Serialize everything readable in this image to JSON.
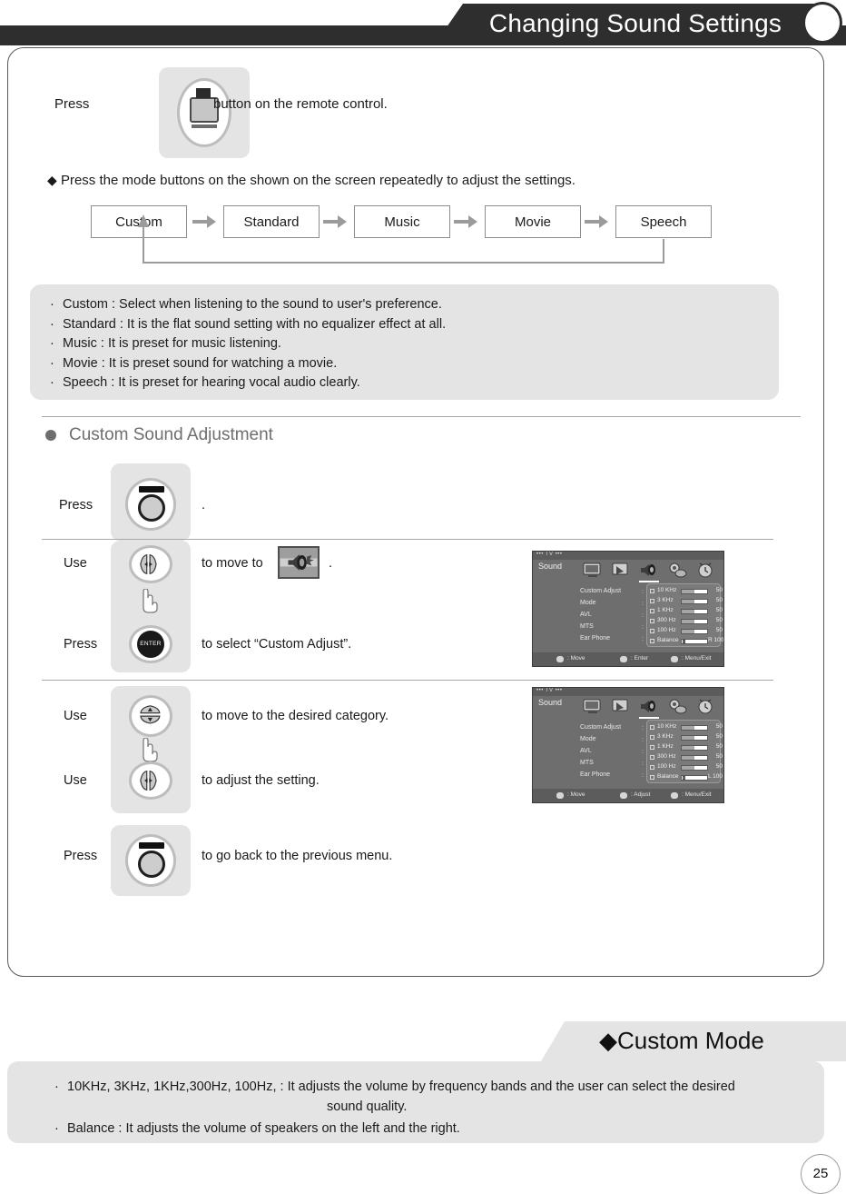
{
  "header": {
    "title": "Changing Sound Settings"
  },
  "press_remote_step": {
    "prefix": "Press",
    "button_icon": "tv-menu-button-icon",
    "suffix": "button on the remote control."
  },
  "flow_note": {
    "marker": "◆",
    "text": "Press the mode buttons on the shown on the screen repeatedly to adjust the settings."
  },
  "mode_flow": {
    "modes": [
      "Custom",
      "Standard",
      "Music",
      "Movie",
      "Speech"
    ],
    "loop_from": "Speech",
    "loop_to": "Custom"
  },
  "mode_descriptions": {
    "bullet": "·",
    "items": [
      "Custom : Select when listening to the sound to user's preference.",
      "Standard : It is the flat sound setting with no equalizer effect at all.",
      "Music : It is preset for music listening.",
      "Movie : It is preset sound for watching a movie.",
      "Speech : It is preset for hearing vocal audio clearly."
    ]
  },
  "section": {
    "title": "Custom Sound Adjustment"
  },
  "steps": [
    {
      "label": "Press",
      "icon": "menu-button-icon",
      "text": "."
    },
    {
      "label": "Use",
      "icon": "left-right-button-icon",
      "text": "to move to",
      "text_after": "."
    },
    {
      "label": "Press",
      "icon": "enter-button-icon",
      "text": "to select “Custom Adjust”."
    },
    {
      "label": "Use",
      "icon": "up-down-button-icon",
      "text": "to  move to the desired category."
    },
    {
      "label": "Use",
      "icon": "left-right-button-icon",
      "text": "to adjust the setting."
    },
    {
      "label": "Press",
      "icon": "menu-button-icon",
      "text": "to go back to the previous menu."
    }
  ],
  "osd_screens": [
    {
      "device_label": "•••  TV  •••",
      "title": "Sound",
      "icons": [
        "picture-icon",
        "screen-icon",
        "sound-icon",
        "setup-icon",
        "time-icon"
      ],
      "selected_icon_index": 2,
      "menu_items": [
        "Custom Adjust",
        "Mode",
        "AVL",
        "MTS",
        "Ear Phone"
      ],
      "eq_rows": [
        {
          "name": "10 KHz",
          "value": "50",
          "fill_pct": 50
        },
        {
          "name": "3 KHz",
          "value": "50",
          "fill_pct": 50
        },
        {
          "name": "1 KHz",
          "value": "50",
          "fill_pct": 50
        },
        {
          "name": "300 Hz",
          "value": "50",
          "fill_pct": 50
        },
        {
          "name": "100 Hz",
          "value": "50",
          "fill_pct": 50
        },
        {
          "name": "Balance",
          "value": "R 100",
          "fill_pct": 0,
          "knob_pct": 5
        }
      ],
      "footer": [
        {
          "glyph": "dpad-icon",
          "text": ": Move"
        },
        {
          "glyph": "enter-icon",
          "text": ": Enter"
        },
        {
          "glyph": "menu-icon",
          "text": ": Menu/Exit"
        }
      ]
    },
    {
      "device_label": "•••  TV  •••",
      "title": "Sound",
      "icons": [
        "picture-icon",
        "screen-icon",
        "sound-icon",
        "setup-icon",
        "time-icon"
      ],
      "selected_icon_index": 2,
      "menu_items": [
        "Custom Adjust",
        "Mode",
        "AVL",
        "MTS",
        "Ear Phone"
      ],
      "eq_rows": [
        {
          "name": "10 KHz",
          "value": "50",
          "fill_pct": 50
        },
        {
          "name": "3 KHz",
          "value": "50",
          "fill_pct": 50
        },
        {
          "name": "1 KHz",
          "value": "50",
          "fill_pct": 50
        },
        {
          "name": "300 Hz",
          "value": "50",
          "fill_pct": 50
        },
        {
          "name": "100 Hz",
          "value": "50",
          "fill_pct": 50
        },
        {
          "name": "Balance",
          "value": "L 100",
          "fill_pct": 0,
          "knob_pct": 5
        }
      ],
      "footer": [
        {
          "glyph": "updown-icon",
          "text": ": Move"
        },
        {
          "glyph": "leftright-icon",
          "text": ": Adjust"
        },
        {
          "glyph": "menu-icon",
          "text": ": Menu/Exit"
        }
      ]
    }
  ],
  "custom_mode": {
    "marker": "◆",
    "title": "Custom Mode",
    "bullet": "·",
    "items": [
      "10KHz, 3KHz, 1KHz,300Hz, 100Hz, : It adjusts the volume by frequency bands and the user can select the desired",
      "sound quality.",
      "Balance : It adjusts the volume of speakers on the left and the right."
    ]
  },
  "page_number": "25",
  "colors": {
    "header_bar": "#2e2e2e",
    "panel_grey": "#e4e4e4",
    "osd_grey": "#6e6e6e",
    "section_grey": "#6e6e6e"
  }
}
